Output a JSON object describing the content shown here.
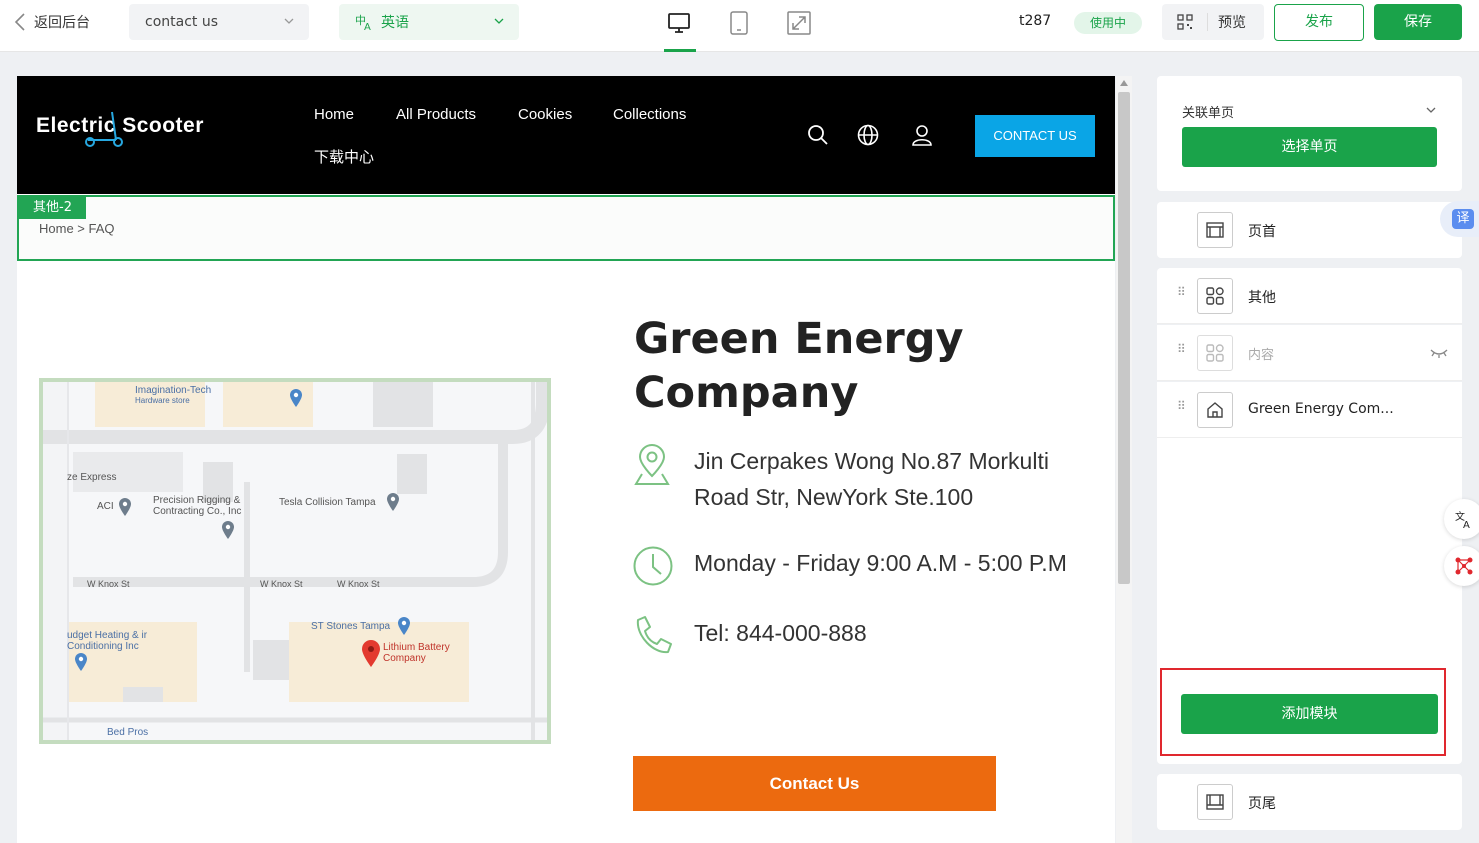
{
  "topbar": {
    "back_label": "返回后台",
    "page_select": "contact us",
    "lang_select": "英语",
    "template_id": "t287",
    "status_badge": "使用中",
    "preview_label": "预览",
    "publish_label": "发布",
    "save_label": "保存",
    "devices": [
      "desktop-icon",
      "tablet-icon",
      "fullscreen-icon"
    ],
    "accent_color": "#1aa34a"
  },
  "site": {
    "logo_text": "Electric Scooter",
    "nav": [
      "Home",
      "All Products",
      "Cookies",
      "Collections",
      "下载中心"
    ],
    "cta_label": "CONTACT US",
    "section_tag": "其他-2",
    "breadcrumb": "Home > FAQ",
    "heading": "Green Energy Company",
    "address": "Jin Cerpakes Wong No.87 Morkulti Road Str, NewYork Ste.100",
    "hours": "Monday - Friday 9:00 A.M - 5:00 P.M",
    "phone": "Tel: 844-000-888",
    "contact_button": "Contact Us",
    "map_labels": {
      "l1": "Imagination-Tech",
      "l1b": "Hardware store",
      "l2": "ze Express",
      "l3": "ACI",
      "l4": "Precision Rigging & Contracting Co., Inc",
      "l5": "Tesla Collision Tampa",
      "l6": "W Knox St",
      "l7": "W Knox St",
      "l8": "W Knox St",
      "l9": "ST Stones Tampa",
      "l10": "Lithium Battery Company",
      "l11": "udget Heating & ir Conditioning Inc",
      "l12": "Bed Pros"
    }
  },
  "panel": {
    "linked_page": "关联单页",
    "select_page_btn": "选择单页",
    "modules": [
      {
        "label": "页首",
        "icon": "layout-icon"
      },
      {
        "label": "其他",
        "icon": "grid-icon"
      },
      {
        "label": "内容",
        "icon": "grid-icon"
      },
      {
        "label": "Green Energy Com...",
        "icon": "home-icon"
      }
    ],
    "add_module_btn": "添加模块",
    "footer_label": "页尾",
    "translate_badge": "译"
  }
}
